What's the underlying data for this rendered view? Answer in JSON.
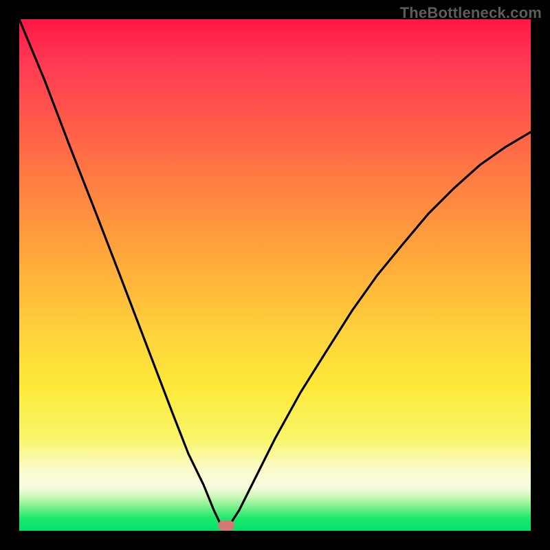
{
  "watermark": {
    "text": "TheBottleneck.com"
  },
  "colors": {
    "black": "#000000",
    "curve": "#000000",
    "marker": "#d37a76",
    "gradient_top": "#ff1744",
    "gradient_mid": "#fde93a",
    "gradient_bottom": "#00e36a"
  },
  "chart_data": {
    "type": "line",
    "title": "",
    "xlabel": "",
    "ylabel": "",
    "xlim": [
      0,
      100
    ],
    "ylim": [
      0,
      100
    ],
    "min_point": {
      "x": 40,
      "y": 0
    },
    "series": [
      {
        "name": "bottleneck-curve",
        "x": [
          0,
          5,
          10,
          15,
          20,
          25,
          30,
          33,
          36,
          38,
          39.5,
          40,
          41,
          43,
          46,
          50,
          55,
          60,
          65,
          70,
          75,
          80,
          85,
          90,
          95,
          100
        ],
        "values": [
          100,
          88,
          75,
          62,
          49,
          36,
          23,
          15,
          9,
          4,
          1,
          0,
          1,
          4,
          10,
          18,
          27,
          35,
          43,
          50,
          56,
          62,
          67,
          71.5,
          75,
          78
        ]
      }
    ],
    "marker": {
      "x": 40.5,
      "y": 0
    }
  }
}
